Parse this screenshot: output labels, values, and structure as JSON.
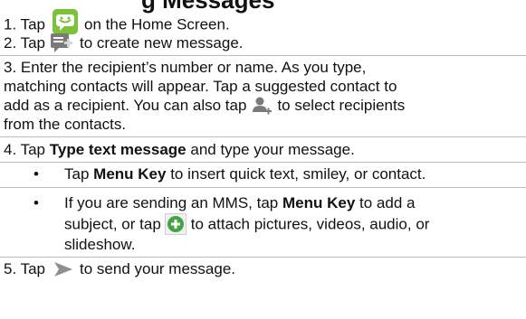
{
  "heading_fragment": "g Messages",
  "steps": {
    "s1_before": "1. Tap",
    "s1_after": "on the Home Screen.",
    "s2_before": "2. Tap",
    "s2_after": "to create new message.",
    "s3_line1": "3. Enter the recipient’s number or name. As you type,",
    "s3_line2": "matching contacts will appear. Tap a suggested contact to",
    "s3_line3_before": "add as a recipient. You can also tap",
    "s3_line3_after": "to select recipients",
    "s3_line4": "from the contacts.",
    "s4_before": "4. Tap",
    "s4_bold": "Type text message",
    "s4_after": "and type your message.",
    "b1_before": "Tap",
    "b1_bold": "Menu Key",
    "b1_after": "to insert quick text, smiley, or contact.",
    "b2_line1_before": "If you are sending an MMS, tap",
    "b2_line1_bold": "Menu Key",
    "b2_line1_after": "to add a",
    "b2_line2_before": "subject, or tap",
    "b2_line2_after": "to attach pictures, videos, audio, or",
    "b2_line3": "slideshow.",
    "s5_before": "5.  Tap",
    "s5_after": "to send your message."
  },
  "icons": {
    "messaging_app": "messaging-app-icon",
    "compose": "compose-message-icon",
    "add_contact": "add-contact-icon",
    "attach": "attach-icon",
    "send": "send-icon"
  },
  "colors": {
    "text": "#111111",
    "divider": "#bdbdbd",
    "app_green": "#7cc33a",
    "attach_green": "#43a347",
    "icon_gray": "#7a7a7a",
    "send_gray": "#8f8f8f"
  }
}
